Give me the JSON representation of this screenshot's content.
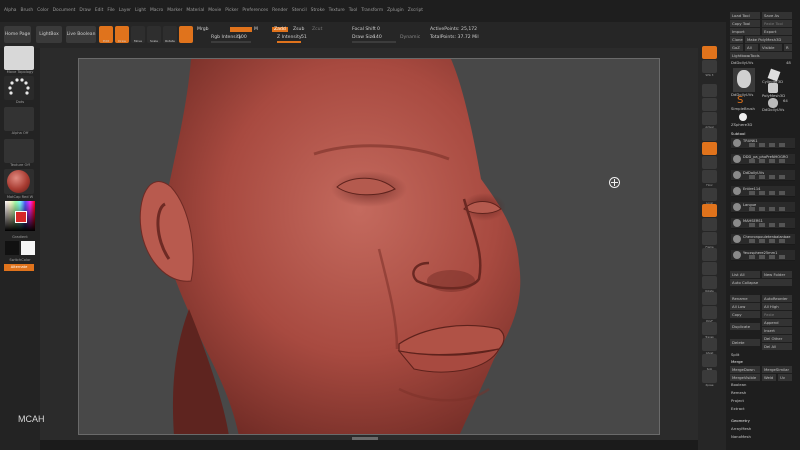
{
  "menubar": [
    "Alpha",
    "Brush",
    "Color",
    "Document",
    "Draw",
    "Edit",
    "File",
    "Layer",
    "Light",
    "Macro",
    "Marker",
    "Material",
    "Movie",
    "Picker",
    "Preferences",
    "Render",
    "Stencil",
    "Stroke",
    "Texture",
    "Tool",
    "Transform",
    "Zplugin",
    "Zscript"
  ],
  "toolbar": {
    "home_page": "Home Page",
    "lightbox": "LightBox",
    "live_boolean": "Live Boolean",
    "edit": "Edit",
    "draw": "Draw",
    "move": "Move",
    "scale": "Scale",
    "rotate": "Rotate",
    "mrgb": "Mrgb",
    "rgb": "Rgb",
    "m": "M",
    "zadd": "Zadd",
    "zsub": "Zsub",
    "zcut": "Zcut",
    "rgb_intensity_label": "Rgb Intensity",
    "rgb_intensity_value": "100",
    "z_intensity_label": "Z Intensity",
    "z_intensity_value": "51",
    "focal_shift_label": "Focal Shift",
    "focal_shift_value": "0",
    "draw_size_label": "Draw Size",
    "draw_size_value": "140",
    "dynamic": "Dynamic",
    "active_points": "ActivePoints: 25,172",
    "total_points": "TotalPoints: 37.72 Mil"
  },
  "left_panel": {
    "brush": "Move Topology",
    "stroke": "Dots",
    "alpha": "Alpha Off",
    "texture": "Texture Off",
    "material": "MatCap Red W",
    "gradient": "Gradient",
    "switch_color": "SwitchColor",
    "alternate": "Alternate"
  },
  "canvas": {
    "watermark": "MCAH"
  },
  "right_shelf": [
    "BPR",
    "SPix 3",
    "Scroll",
    "Zoom",
    "Actual",
    "AAHalf",
    "Dynamic",
    "Persp",
    "Floor",
    "Local",
    "L.Sym",
    "Gxyz",
    "Frame",
    "Move",
    "Zoom3D",
    "Rotate",
    "Line Fill",
    "PolyF",
    "Transp",
    "Ghost",
    "Solo",
    "Xpose"
  ],
  "tray": {
    "load_tool": "Load Tool",
    "save_as": "Save As",
    "copy_tool": "Copy Tool",
    "paste_tool": "Paste Tool",
    "import": "Import",
    "export": "Export",
    "clone": "Clone",
    "make_polymesh": "Make PolyMesh3D",
    "goz": "GoZ",
    "all": "All",
    "visible": "Visible",
    "r": "R",
    "lightbox_tools": "Lightbox▸Tools",
    "current_tool": "DdDollyUVs",
    "current_tool_num": "48",
    "tools": [
      "DdDollyUVs",
      "Cylinder3D",
      "SimpleBrush",
      "PolyMesh3D",
      "DdDollyUVs"
    ],
    "tool_count": "64",
    "zsphere": "ZSphere3D",
    "subtool_title": "Subtool",
    "subtools": [
      "TRUNK1",
      "DDD_pa_phoPreNHOGRO",
      "DdDollyUVs",
      "Entire114",
      "Langue",
      "MAHSERS1",
      "Chevronpouletenbalanbae",
      "Yeuxsphere25mm1"
    ],
    "list_all": "List All",
    "new_folder": "New Folder",
    "auto_collapse": "Auto Collapse",
    "rename": "Rename",
    "autoreorder": "AutoReorder",
    "all_low": "All Low",
    "all_high": "All High",
    "copy": "Copy",
    "paste": "Paste",
    "append": "Append",
    "duplicate": "Duplicate",
    "insert": "Insert",
    "delete": "Delete",
    "del_other": "Del Other",
    "del_all": "Del All",
    "split": "Split",
    "merge": "Merge",
    "merge_down": "MergeDown",
    "merge_similar": "MergeSimilar",
    "merge_visible": "MergeVisible",
    "weld": "Weld",
    "uv": "Uv",
    "boolean": "Boolean",
    "remesh": "Remesh",
    "project": "Project",
    "extract": "Extract",
    "geometry": "Geometry",
    "array_mesh": "ArrayMesh",
    "nano_mesh": "NanoMesh"
  },
  "colors": {
    "accent": "#e0731c",
    "skin": "#a84a40",
    "canvas": "#484848"
  }
}
